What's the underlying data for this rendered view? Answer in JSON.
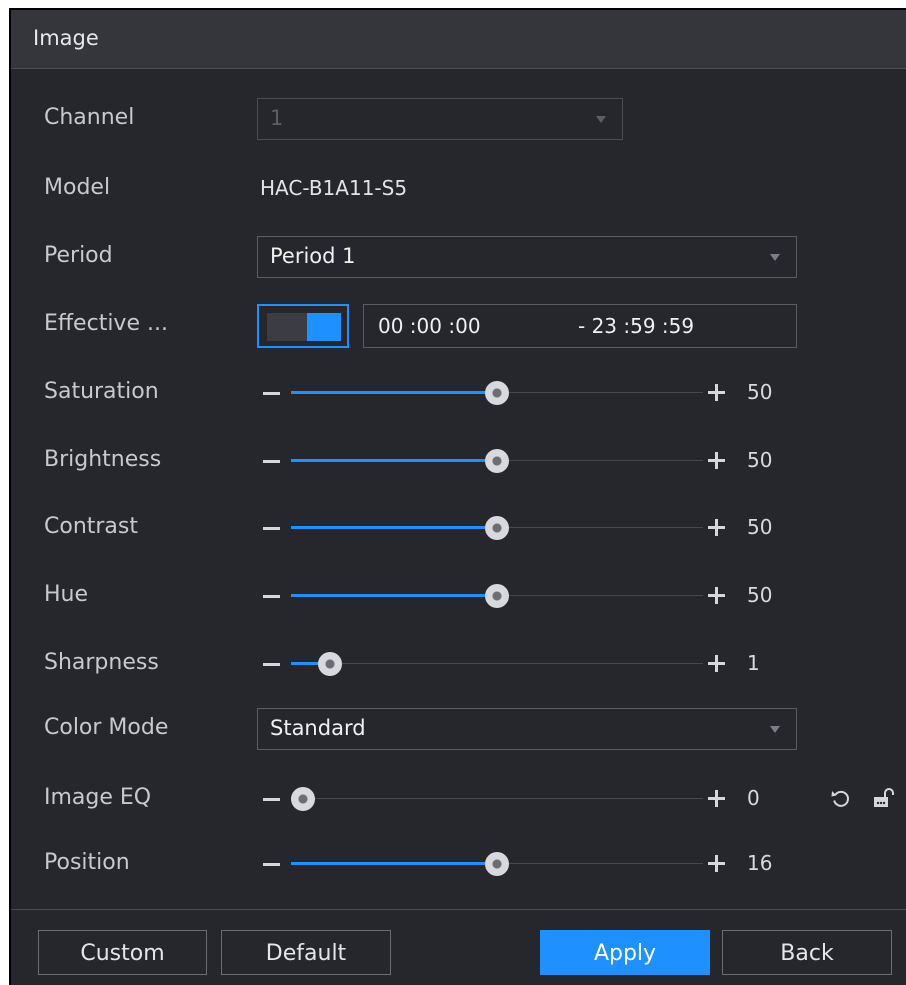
{
  "window": {
    "title": "Image"
  },
  "fields": {
    "channel": {
      "label": "Channel",
      "value": "1"
    },
    "model": {
      "label": "Model",
      "value": "HAC-B1A11-S5"
    },
    "period": {
      "label": "Period",
      "value": "Period 1"
    },
    "effective": {
      "label": "Effective ...",
      "enabled": true,
      "start": "00 :00 :00",
      "end": "- 23 :59 :59"
    },
    "saturation": {
      "label": "Saturation",
      "value": "50",
      "fraction": 0.5
    },
    "brightness": {
      "label": "Brightness",
      "value": "50",
      "fraction": 0.5
    },
    "contrast": {
      "label": "Contrast",
      "value": "50",
      "fraction": 0.5
    },
    "hue": {
      "label": "Hue",
      "value": "50",
      "fraction": 0.5
    },
    "sharpness": {
      "label": "Sharpness",
      "value": "1",
      "fraction": 0.095
    },
    "color_mode": {
      "label": "Color Mode",
      "value": "Standard"
    },
    "image_eq": {
      "label": "Image EQ",
      "value": "0",
      "fraction": 0.03
    },
    "position": {
      "label": "Position",
      "value": "16",
      "fraction": 0.5
    }
  },
  "buttons": {
    "custom": "Custom",
    "default": "Default",
    "apply": "Apply",
    "back": "Back"
  },
  "icons": {
    "refresh": "refresh-icon",
    "lock": "unlock-icon",
    "dropdown": "chevron-down-icon"
  },
  "colors": {
    "accent": "#1e90ff",
    "background": "#25272c",
    "titlebar": "#34363c"
  }
}
